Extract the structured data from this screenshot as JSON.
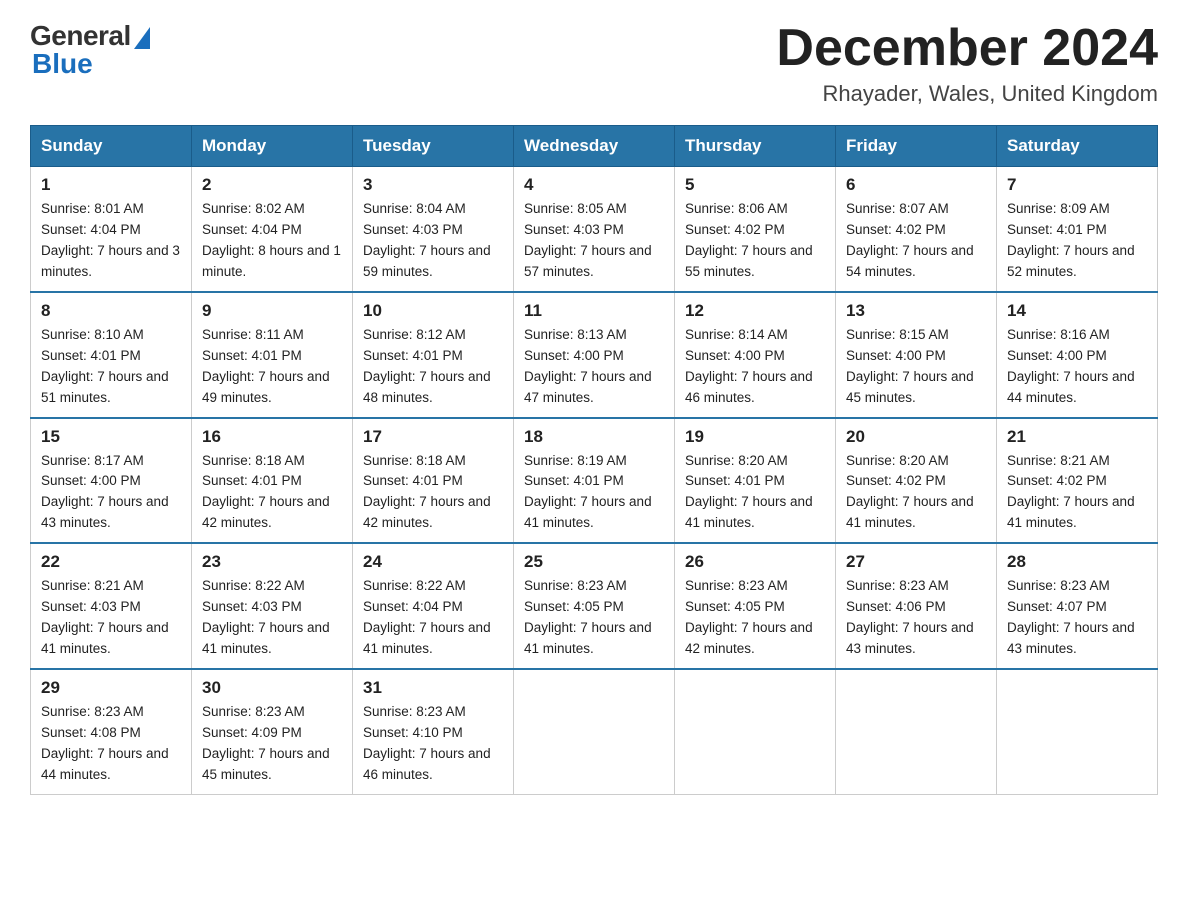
{
  "header": {
    "logo_general": "General",
    "logo_blue": "Blue",
    "month_title": "December 2024",
    "location": "Rhayader, Wales, United Kingdom"
  },
  "weekdays": [
    "Sunday",
    "Monday",
    "Tuesday",
    "Wednesday",
    "Thursday",
    "Friday",
    "Saturday"
  ],
  "weeks": [
    [
      {
        "day": "1",
        "sunrise": "8:01 AM",
        "sunset": "4:04 PM",
        "daylight": "7 hours and 3 minutes."
      },
      {
        "day": "2",
        "sunrise": "8:02 AM",
        "sunset": "4:04 PM",
        "daylight": "8 hours and 1 minute."
      },
      {
        "day": "3",
        "sunrise": "8:04 AM",
        "sunset": "4:03 PM",
        "daylight": "7 hours and 59 minutes."
      },
      {
        "day": "4",
        "sunrise": "8:05 AM",
        "sunset": "4:03 PM",
        "daylight": "7 hours and 57 minutes."
      },
      {
        "day": "5",
        "sunrise": "8:06 AM",
        "sunset": "4:02 PM",
        "daylight": "7 hours and 55 minutes."
      },
      {
        "day": "6",
        "sunrise": "8:07 AM",
        "sunset": "4:02 PM",
        "daylight": "7 hours and 54 minutes."
      },
      {
        "day": "7",
        "sunrise": "8:09 AM",
        "sunset": "4:01 PM",
        "daylight": "7 hours and 52 minutes."
      }
    ],
    [
      {
        "day": "8",
        "sunrise": "8:10 AM",
        "sunset": "4:01 PM",
        "daylight": "7 hours and 51 minutes."
      },
      {
        "day": "9",
        "sunrise": "8:11 AM",
        "sunset": "4:01 PM",
        "daylight": "7 hours and 49 minutes."
      },
      {
        "day": "10",
        "sunrise": "8:12 AM",
        "sunset": "4:01 PM",
        "daylight": "7 hours and 48 minutes."
      },
      {
        "day": "11",
        "sunrise": "8:13 AM",
        "sunset": "4:00 PM",
        "daylight": "7 hours and 47 minutes."
      },
      {
        "day": "12",
        "sunrise": "8:14 AM",
        "sunset": "4:00 PM",
        "daylight": "7 hours and 46 minutes."
      },
      {
        "day": "13",
        "sunrise": "8:15 AM",
        "sunset": "4:00 PM",
        "daylight": "7 hours and 45 minutes."
      },
      {
        "day": "14",
        "sunrise": "8:16 AM",
        "sunset": "4:00 PM",
        "daylight": "7 hours and 44 minutes."
      }
    ],
    [
      {
        "day": "15",
        "sunrise": "8:17 AM",
        "sunset": "4:00 PM",
        "daylight": "7 hours and 43 minutes."
      },
      {
        "day": "16",
        "sunrise": "8:18 AM",
        "sunset": "4:01 PM",
        "daylight": "7 hours and 42 minutes."
      },
      {
        "day": "17",
        "sunrise": "8:18 AM",
        "sunset": "4:01 PM",
        "daylight": "7 hours and 42 minutes."
      },
      {
        "day": "18",
        "sunrise": "8:19 AM",
        "sunset": "4:01 PM",
        "daylight": "7 hours and 41 minutes."
      },
      {
        "day": "19",
        "sunrise": "8:20 AM",
        "sunset": "4:01 PM",
        "daylight": "7 hours and 41 minutes."
      },
      {
        "day": "20",
        "sunrise": "8:20 AM",
        "sunset": "4:02 PM",
        "daylight": "7 hours and 41 minutes."
      },
      {
        "day": "21",
        "sunrise": "8:21 AM",
        "sunset": "4:02 PM",
        "daylight": "7 hours and 41 minutes."
      }
    ],
    [
      {
        "day": "22",
        "sunrise": "8:21 AM",
        "sunset": "4:03 PM",
        "daylight": "7 hours and 41 minutes."
      },
      {
        "day": "23",
        "sunrise": "8:22 AM",
        "sunset": "4:03 PM",
        "daylight": "7 hours and 41 minutes."
      },
      {
        "day": "24",
        "sunrise": "8:22 AM",
        "sunset": "4:04 PM",
        "daylight": "7 hours and 41 minutes."
      },
      {
        "day": "25",
        "sunrise": "8:23 AM",
        "sunset": "4:05 PM",
        "daylight": "7 hours and 41 minutes."
      },
      {
        "day": "26",
        "sunrise": "8:23 AM",
        "sunset": "4:05 PM",
        "daylight": "7 hours and 42 minutes."
      },
      {
        "day": "27",
        "sunrise": "8:23 AM",
        "sunset": "4:06 PM",
        "daylight": "7 hours and 43 minutes."
      },
      {
        "day": "28",
        "sunrise": "8:23 AM",
        "sunset": "4:07 PM",
        "daylight": "7 hours and 43 minutes."
      }
    ],
    [
      {
        "day": "29",
        "sunrise": "8:23 AM",
        "sunset": "4:08 PM",
        "daylight": "7 hours and 44 minutes."
      },
      {
        "day": "30",
        "sunrise": "8:23 AM",
        "sunset": "4:09 PM",
        "daylight": "7 hours and 45 minutes."
      },
      {
        "day": "31",
        "sunrise": "8:23 AM",
        "sunset": "4:10 PM",
        "daylight": "7 hours and 46 minutes."
      },
      null,
      null,
      null,
      null
    ]
  ],
  "labels": {
    "sunrise": "Sunrise:",
    "sunset": "Sunset:",
    "daylight": "Daylight:"
  }
}
